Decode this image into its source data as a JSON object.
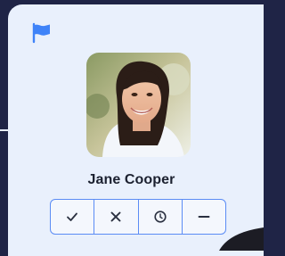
{
  "card": {
    "name": "Jane Cooper",
    "flag_icon": "flag-icon",
    "avatar_icon": "avatar-photo"
  },
  "actions": [
    {
      "icon": "check-icon",
      "label": "approve"
    },
    {
      "icon": "close-icon",
      "label": "reject"
    },
    {
      "icon": "clock-icon",
      "label": "snooze"
    },
    {
      "icon": "minus-icon",
      "label": "dismiss"
    }
  ],
  "colors": {
    "background": "#1f2446",
    "card": "#e9f0fc",
    "accent": "#5b8cf5",
    "flag": "#3f83f8",
    "text": "#1c2130"
  }
}
